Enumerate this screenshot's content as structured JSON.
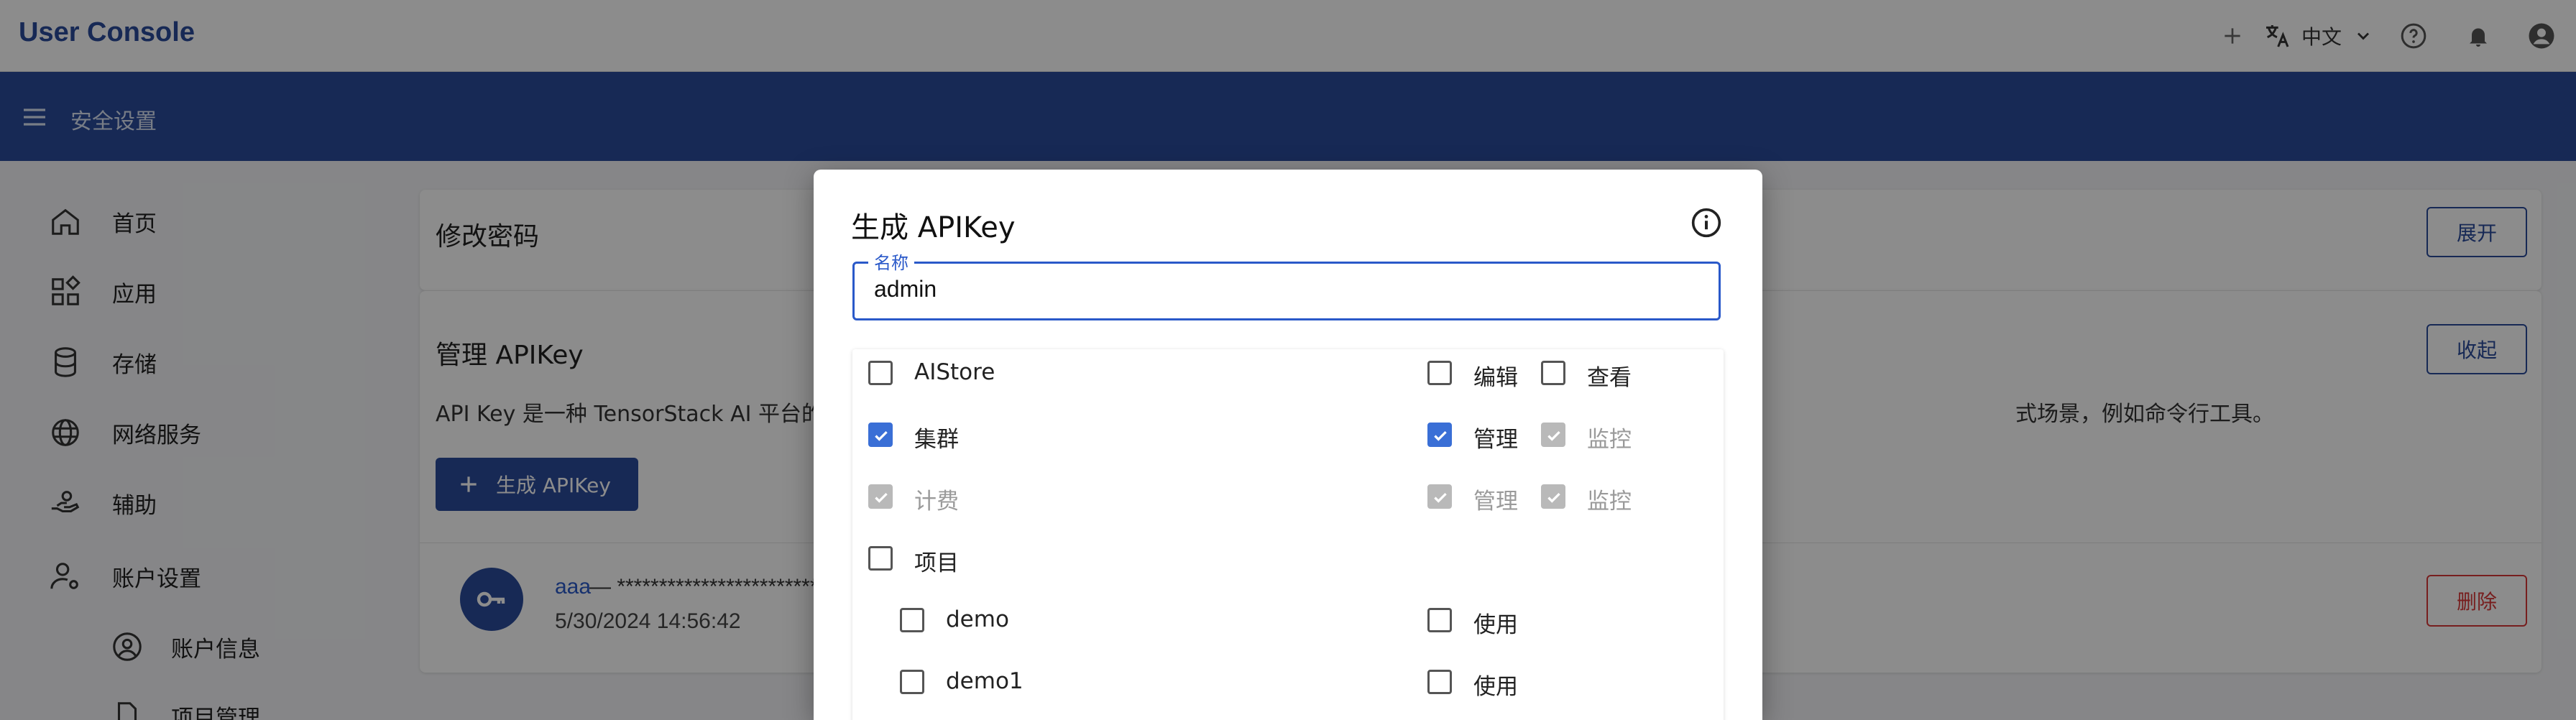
{
  "app": {
    "title": "User Console",
    "language": "中文"
  },
  "subbar": {
    "title": "安全设置"
  },
  "sidebar": {
    "items": [
      {
        "label": "首页"
      },
      {
        "label": "应用"
      },
      {
        "label": "存储"
      },
      {
        "label": "网络服务"
      },
      {
        "label": "辅助"
      },
      {
        "label": "账户设置"
      }
    ],
    "subitems": [
      {
        "label": "账户信息"
      },
      {
        "label": "项目管理"
      }
    ]
  },
  "password_card": {
    "title": "修改密码",
    "expand_label": "展开"
  },
  "apikey_card": {
    "title": "管理 APIKey",
    "collapse_label": "收起",
    "description_start": "API Key 是一种 TensorStack AI 平台的",
    "description_end": "式场景，例如命令行工具。",
    "generate_label": "生成 APIKey",
    "key_name": "aaa",
    "key_masked": " — ************************",
    "key_time": "5/30/2024 14:56:42",
    "delete_label": "删除"
  },
  "dialog": {
    "title": "生成 APIKey",
    "name_label": "名称",
    "name_value": "admin",
    "permissions": [
      {
        "label": "AIStore",
        "checked": false,
        "disabled": false,
        "perms": [
          {
            "label": "编辑",
            "checked": false,
            "disabled": false
          },
          {
            "label": "查看",
            "checked": false,
            "disabled": false
          }
        ]
      },
      {
        "label": "集群",
        "checked": true,
        "disabled": false,
        "perms": [
          {
            "label": "管理",
            "checked": true,
            "disabled": false
          },
          {
            "label": "监控",
            "checked": true,
            "disabled": true
          }
        ]
      },
      {
        "label": "计费",
        "checked": true,
        "disabled": true,
        "perms": [
          {
            "label": "管理",
            "checked": true,
            "disabled": true
          },
          {
            "label": "监控",
            "checked": true,
            "disabled": true
          }
        ]
      },
      {
        "label": "项目",
        "checked": false,
        "disabled": false,
        "perms": []
      },
      {
        "label": "demo",
        "checked": false,
        "disabled": false,
        "indent": true,
        "perms": [
          {
            "label": "使用",
            "checked": false,
            "disabled": false
          }
        ]
      },
      {
        "label": "demo1",
        "checked": false,
        "disabled": false,
        "indent": true,
        "perms": [
          {
            "label": "使用",
            "checked": false,
            "disabled": false
          }
        ]
      }
    ]
  },
  "colors": {
    "primary": "#2a4b9c",
    "accent": "#3a6fd6",
    "danger": "#d93838"
  }
}
